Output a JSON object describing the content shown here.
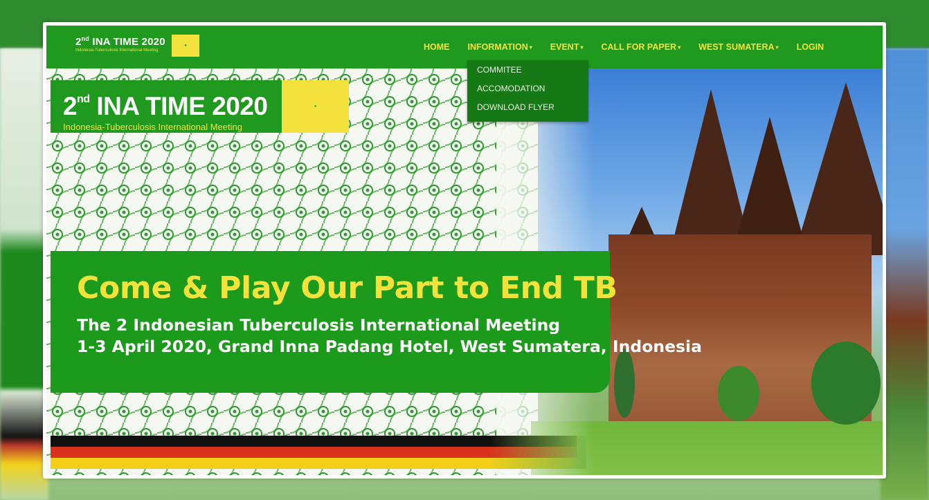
{
  "navbar": {
    "brand_title": "2",
    "brand_title_sup": "nd",
    "brand_title_rest": " INA TIME 2020",
    "brand_subtitle": "Indonesia-Tuberculosis International Meeting",
    "items": [
      {
        "label": "HOME",
        "has_caret": false
      },
      {
        "label": "INFORMATION",
        "has_caret": true
      },
      {
        "label": "EVENT",
        "has_caret": true
      },
      {
        "label": "CALL FOR PAPER",
        "has_caret": true
      },
      {
        "label": "WEST SUMATERA",
        "has_caret": true
      },
      {
        "label": "LOGIN",
        "has_caret": false
      }
    ],
    "caret_glyph": "▾"
  },
  "dropdown": {
    "parent": "INFORMATION",
    "items": [
      "COMMITEE",
      "ACCOMODATION",
      "DOWNLOAD FLYER"
    ]
  },
  "hero": {
    "logo_title_num": "2",
    "logo_title_sup": "nd",
    "logo_title_rest": " INA TIME 2020",
    "logo_subtitle": "Indonesia-Tuberculosis International Meeting",
    "headline": "Come & Play Our Part to End TB",
    "line1": "The 2 Indonesian Tuberculosis International Meeting",
    "line2": "1-3 April 2020, Grand Inna Padang Hotel, West Sumatera, Indonesia"
  },
  "colors": {
    "brand_green": "#1f9a1f",
    "brand_yellow": "#f4e23c",
    "dropdown_bg": "#157a15",
    "stripe_black": "#111111",
    "stripe_red": "#d8321e",
    "stripe_yellow": "#f3cf1a"
  }
}
